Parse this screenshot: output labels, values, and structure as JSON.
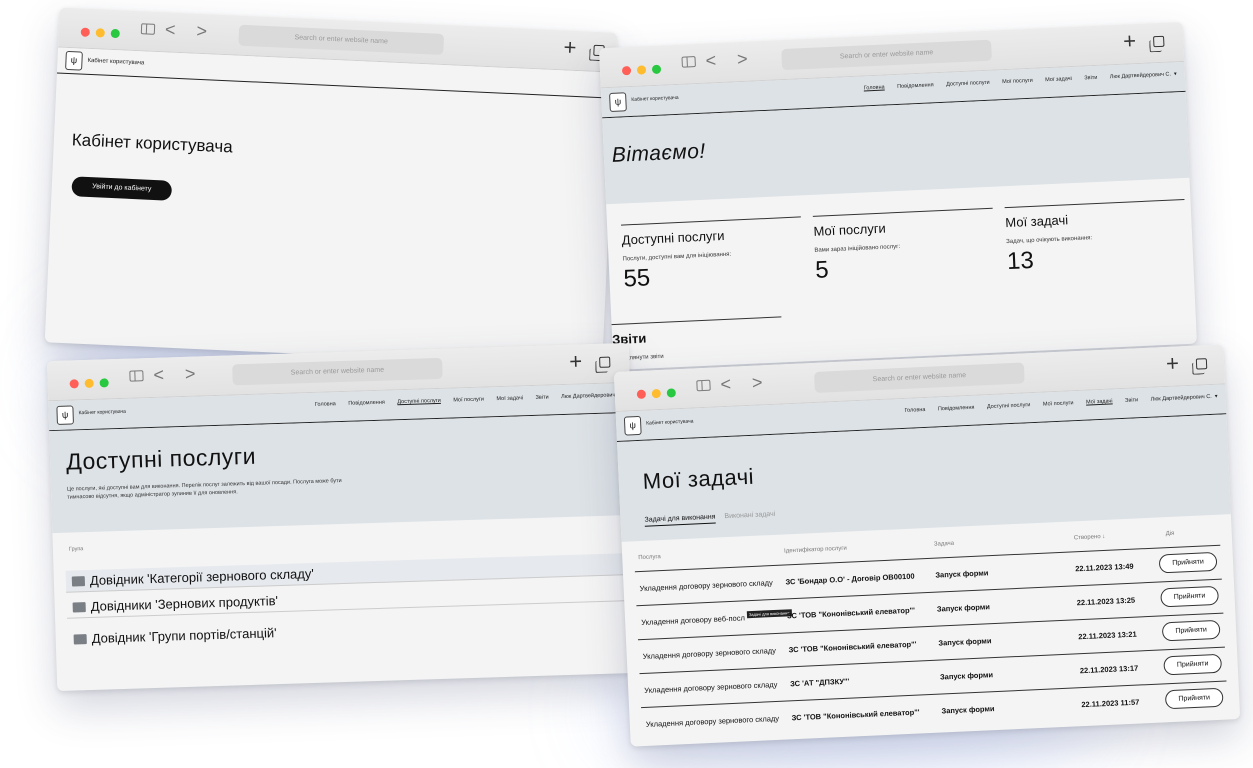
{
  "browser": {
    "url_placeholder": "Search or enter website name",
    "plus_label": "+",
    "dot_colors": [
      "#ff5f57",
      "#febc2e",
      "#28c840"
    ],
    "back_fwd": "< >"
  },
  "site": {
    "logo_text": "Кабінет користувача",
    "logo_icon": "trident-icon",
    "nav": [
      "Головна",
      "Повідомлення",
      "Доступні послуги",
      "Мої послуги",
      "Мої задачі",
      "Звіти"
    ],
    "user": "Люк Дартвейдерович С."
  },
  "landing": {
    "title": "Кабінет користувача",
    "login_button": "Увійти до кабінету"
  },
  "dashboard": {
    "greeting": "Вітаємо!",
    "cards": [
      {
        "title": "Доступні послуги",
        "desc": "Послуги, доступні вам для ініціювання:",
        "value": "55"
      },
      {
        "title": "Мої послуги",
        "desc": "Вами зараз ініційовано послуг:",
        "value": "5"
      },
      {
        "title": "Мої задачі",
        "desc": "Задач, що очікують виконання:",
        "value": "13"
      },
      {
        "title": "Звіти",
        "desc": "Переглянути звіти"
      }
    ]
  },
  "services": {
    "title": "Доступні послуги",
    "desc_line1": "Це послуги, які доступні вам для виконання. Перелік послуг залежить від вашої посади. Послуга може бути",
    "desc_line2": "тимчасово відсутня, якщо адміністратор зупинив її для оновлення.",
    "group_label": "Група",
    "items": [
      "Довідник 'Категорії зернового складу'",
      "Довідники 'Зернових продуктів'",
      "Довідник 'Групи портів/станцій'"
    ]
  },
  "tasks": {
    "title": "Мої задачі",
    "tab_active": "Задачі для виконання",
    "tab_inactive": "Виконані задачі",
    "columns": [
      "Послуга",
      "Ідентифікатор послуги",
      "Задача",
      "Створено ↓",
      "Дія"
    ],
    "tooltip": "Задачі для виконання",
    "rows": [
      {
        "service": "Укладення договору зернового складу",
        "id": "ЗС 'Бондар О.О' - Договір ОВ00100",
        "task": "Запуск форми",
        "created": "22.11.2023 13:49",
        "action": "Прийняти"
      },
      {
        "service": "Укладення договору веб-посл",
        "id": "ЗС 'ТОВ \"Кононівський елеватор\"'",
        "task": "Запуск форми",
        "created": "22.11.2023 13:25",
        "action": "Прийняти"
      },
      {
        "service": "Укладення договору зернового складу",
        "id": "ЗС 'ТОВ \"Кононівський елеватор\"'",
        "task": "Запуск форми",
        "created": "22.11.2023 13:21",
        "action": "Прийняти"
      },
      {
        "service": "Укладення договору зернового складу",
        "id": "ЗС 'АТ \"ДПЗКУ\"'",
        "task": "Запуск форми",
        "created": "22.11.2023 13:17",
        "action": "Прийняти"
      },
      {
        "service": "Укладення договору зернового складу",
        "id": "ЗС 'ТОВ \"Кононівський елеватор\"'",
        "task": "Запуск форми",
        "created": "22.11.2023 11:57",
        "action": "Прийняти"
      }
    ]
  }
}
